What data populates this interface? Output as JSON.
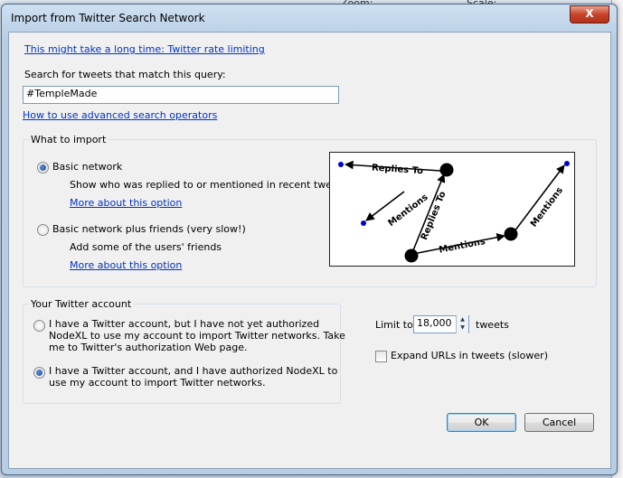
{
  "dialog": {
    "title": "Import from Twitter Search Network",
    "close_label": "X"
  },
  "rate_limit_link": "This might take a long time: Twitter rate limiting",
  "query": {
    "label": "Search for tweets that match this query:",
    "value": "#TempleMade"
  },
  "advanced_link": "How to use advanced search operators",
  "what_to_import": {
    "title": "What to import",
    "options": [
      {
        "label": "Basic network",
        "description": "Show who was replied to or mentioned in recent tweets",
        "link": "More about this option",
        "selected": true
      },
      {
        "label": "Basic network plus friends (very slow!)",
        "description": "Add some of the users' friends",
        "link": "More about this option",
        "selected": false
      }
    ],
    "diagram": {
      "edge_labels": [
        "Replies To",
        "Mentions",
        "Replies To",
        "Mentions",
        "Mentions"
      ]
    }
  },
  "account": {
    "title": "Your Twitter account",
    "options": [
      {
        "line1": "I have a Twitter account, but I have not yet authorized",
        "line2": "NodeXL to use my account to import Twitter networks.  Take",
        "line3": "me to Twitter's authorization Web page.",
        "selected": false
      },
      {
        "line1": "I have a Twitter account, and I have authorized NodeXL to",
        "line2": "use my account to import Twitter networks.",
        "selected": true
      }
    ]
  },
  "limit": {
    "label": "Limit to",
    "value": "18,000",
    "unit": "tweets"
  },
  "expand_urls": {
    "label": "Expand URLs in tweets (slower)",
    "checked": false
  },
  "buttons": {
    "ok": "OK",
    "cancel": "Cancel"
  },
  "background": {
    "zoom_label": "Zoom:",
    "scale_label": "Scale:"
  },
  "colors": {
    "link": "#0033cc",
    "client_bg": "#f0f0f0",
    "close_red": "#c7442b"
  }
}
